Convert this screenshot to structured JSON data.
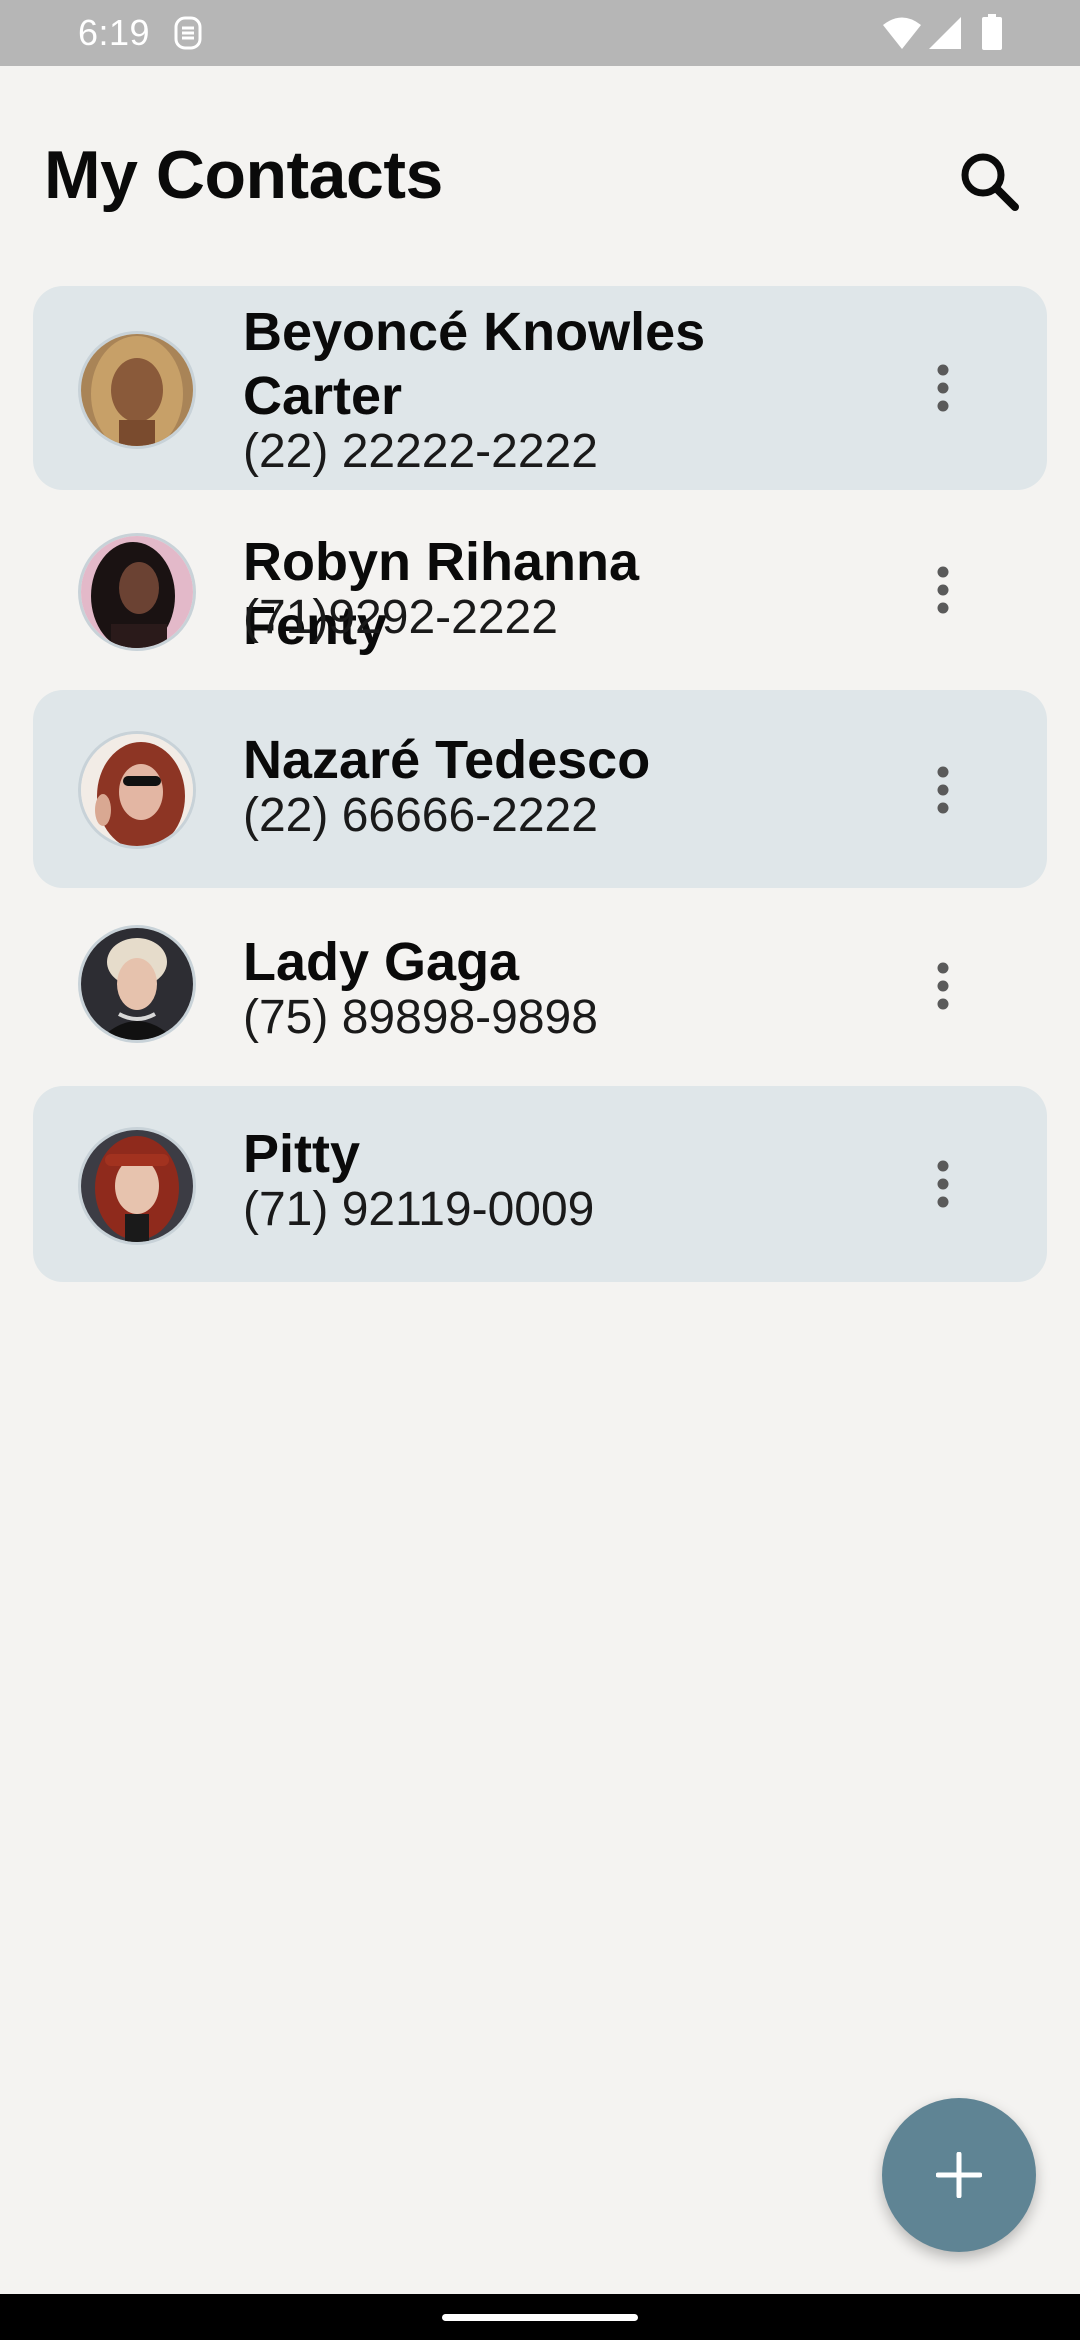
{
  "status_bar": {
    "time": "6:19"
  },
  "header": {
    "title": "My Contacts"
  },
  "contacts": [
    {
      "name": "Beyoncé Knowles Carter",
      "phone": "(22) 22222-2222"
    },
    {
      "name": "Robyn Rihanna Fenty",
      "phone": "(71)9292-2222"
    },
    {
      "name": "Nazaré Tedesco",
      "phone": "(22) 66666-2222"
    },
    {
      "name": "Lady Gaga",
      "phone": "(75) 89898-9898"
    },
    {
      "name": "Pitty",
      "phone": "(71) 92119-0009"
    }
  ],
  "colors": {
    "background": "#f4f3f1",
    "card_shaded": "#dfe6e9",
    "fab": "#5f8494",
    "status_bar": "#b6b6b6"
  },
  "icons": {
    "search": "search-icon",
    "more": "more-vert-icon",
    "add": "add-icon"
  }
}
